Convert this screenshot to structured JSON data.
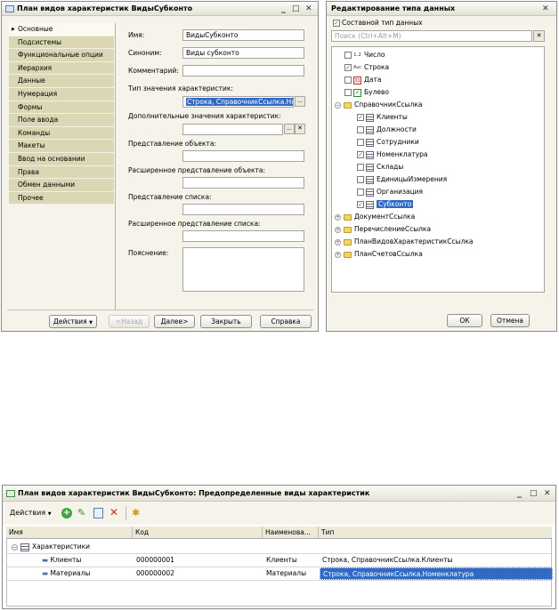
{
  "top_window": {
    "title": "План видов характеристик ВидыСубконто",
    "controls": {
      "minimize": "_",
      "maximize": "□",
      "close": "✕"
    },
    "nav": [
      "Основные",
      "Подсистемы",
      "Функциональные опции",
      "Иерархия",
      "Данные",
      "Нумерация",
      "Формы",
      "Поле ввода",
      "Команды",
      "Макеты",
      "Ввод на основании",
      "Права",
      "Обмен данными",
      "Прочее"
    ],
    "fields": {
      "name_label": "Имя:",
      "name_value": "ВидыСубконто",
      "synonym_label": "Синоним:",
      "synonym_value": "Виды субконто",
      "comment_label": "Комментарий:",
      "comment_value": "",
      "type_label": "Тип значения характеристик:",
      "type_value": "Строка, СправочникСсылка.Ном",
      "extra_label": "Дополнительные значения характеристик:",
      "extra_value": "",
      "obj_repr_label": "Представление объекта:",
      "obj_ext_label": "Расширенное представление объекта:",
      "list_repr_label": "Представление списка:",
      "list_ext_label": "Расширенное представление списка:",
      "expl_label": "Пояснение:"
    },
    "buttons": {
      "actions": "Действия",
      "back": "<Назад",
      "next": "Далее>",
      "close": "Закрыть",
      "help": "Справка",
      "ellipsis": "...",
      "clear": "✕"
    }
  },
  "type_editor": {
    "title": "Редактирование типа данных",
    "close": "✕",
    "composite_label": "Составной тип данных",
    "search_placeholder": "Поиск (Ctrl+Alt+M)",
    "tree": [
      {
        "label": "Число",
        "checked": false,
        "icon": "1.2"
      },
      {
        "label": "Строка",
        "checked": true,
        "icon": "Aᵦc"
      },
      {
        "label": "Дата",
        "checked": false,
        "icon": "31"
      },
      {
        "label": "Булево",
        "checked": false,
        "icon": "✓"
      },
      {
        "label": "СправочникСсылка"
      },
      {
        "label": "Клиенты",
        "checked": true
      },
      {
        "label": "Должности",
        "checked": false
      },
      {
        "label": "Сотрудники",
        "checked": false
      },
      {
        "label": "Номенклатура",
        "checked": true
      },
      {
        "label": "Склады",
        "checked": false
      },
      {
        "label": "ЕдиницыИзмерения",
        "checked": false
      },
      {
        "label": "Организация",
        "checked": false
      },
      {
        "label": "Субконто",
        "checked": true
      },
      {
        "label": "ДокументСсылка"
      },
      {
        "label": "ПеречислениеСсылка"
      },
      {
        "label": "ПланВидовХарактеристикСсылка"
      },
      {
        "label": "ПланСчетовСсылка"
      }
    ],
    "ok": "ОК",
    "cancel": "Отмена"
  },
  "bottom_window": {
    "title": "План видов характеристик ВидыСубконто: Предопределенные виды характеристик",
    "actions": "Действия",
    "columns": [
      "Имя",
      "Код",
      "Наименова...",
      "Тип"
    ],
    "root": "Характеристики",
    "rows": [
      {
        "name": "Клиенты",
        "code": "000000001",
        "title": "Клиенты",
        "type": "Строка, СправочникСсылка.Клиенты"
      },
      {
        "name": "Материалы",
        "code": "000000002",
        "title": "Материалы",
        "type": "Строка, СправочникСсылка.Номенклатура"
      }
    ]
  }
}
